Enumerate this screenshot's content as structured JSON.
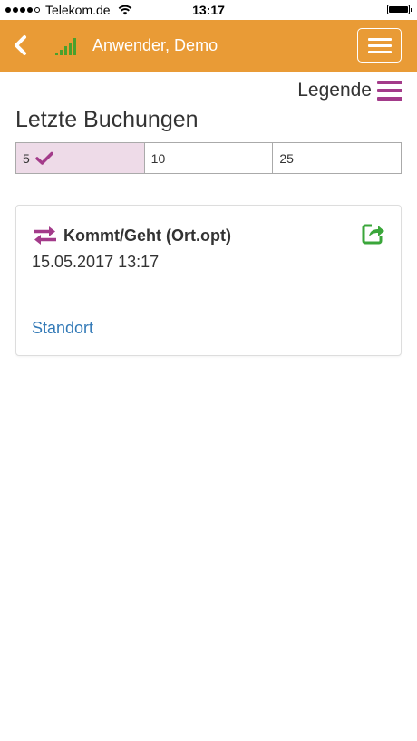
{
  "status_bar": {
    "carrier": "Telekom.de",
    "time": "13:17",
    "signal_dots_filled": 4
  },
  "header": {
    "user_name": "Anwender, Demo",
    "accent_color": "#e99b36"
  },
  "legend": {
    "label": "Legende",
    "icon_color": "#a33b8a"
  },
  "page": {
    "title": "Letzte Buchungen"
  },
  "count_selector": {
    "options": [
      "5",
      "10",
      "25"
    ],
    "selected": "5",
    "selected_bg": "#eedbe8"
  },
  "booking": {
    "title": "Kommt/Geht (Ort.opt)",
    "datetime": "15.05.2017 13:17",
    "link": "Standort",
    "link_color": "#337ab7",
    "share_color": "#3aa63a"
  }
}
